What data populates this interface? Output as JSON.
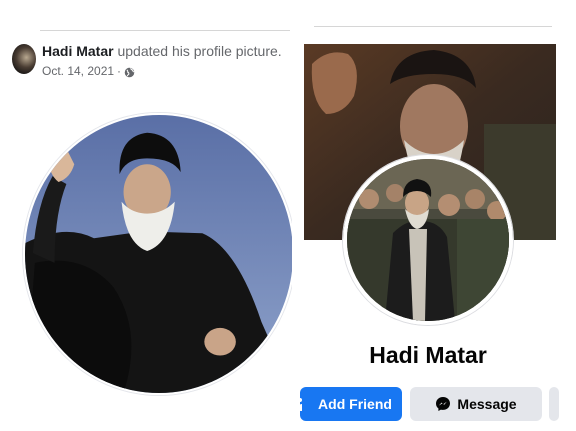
{
  "post": {
    "author": "Hadi Matar",
    "action": "updated his profile picture.",
    "date": "Oct. 14, 2021",
    "separator": "·",
    "audience_icon": "globe-icon"
  },
  "profile": {
    "name": "Hadi Matar",
    "add_friend_label": "Add Friend",
    "message_label": "Message",
    "add_friend_icon": "add-friend-icon",
    "message_icon": "messenger-icon"
  },
  "colors": {
    "primary_blue": "#1877f2",
    "secondary_button": "#e4e6eb",
    "text_primary": "#050505",
    "text_secondary": "#65676b"
  }
}
